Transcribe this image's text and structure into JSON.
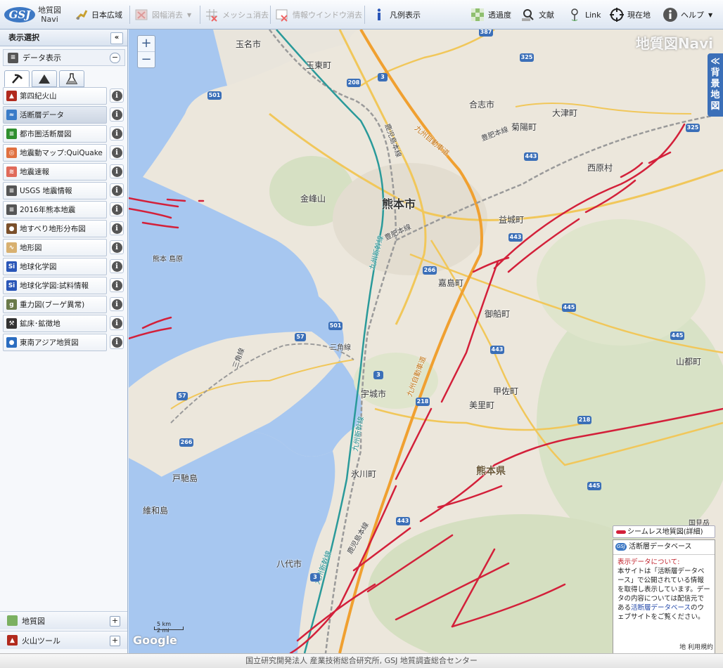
{
  "app": {
    "logo_line1": "地質図",
    "logo_line2": "Navi",
    "logo_badge": "GSJ"
  },
  "toolbar": {
    "japan_wide": "日本広域",
    "clear_legend_img": "図幅消去",
    "clear_mesh": "メッシュ消去",
    "clear_info_window": "情報ウインドウ消去",
    "show_legend": "凡例表示",
    "transparency": "透過度",
    "literature": "文献",
    "link": "Link",
    "current_location": "現在地",
    "help": "ヘルプ"
  },
  "sidebar": {
    "title": "表示選択",
    "data_display": "データ表示",
    "layers": [
      {
        "label": "第四紀火山",
        "color": "#b12a1e",
        "glyph": "▲"
      },
      {
        "label": "活断層データ",
        "color": "#3a7bc8",
        "glyph": "≈"
      },
      {
        "label": "都市圏活断層図",
        "color": "#2f8f2f",
        "glyph": "≡"
      },
      {
        "label": "地震動マップ:QuiQuake",
        "color": "#e07040",
        "glyph": "◎"
      },
      {
        "label": "地震速報",
        "color": "#e06a5a",
        "glyph": "≋"
      },
      {
        "label": "USGS 地震情報",
        "color": "#555555",
        "glyph": "≡"
      },
      {
        "label": "2016年熊本地震",
        "color": "#555555",
        "glyph": "≡"
      },
      {
        "label": "地すべり地形分布図",
        "color": "#7a4f2a",
        "glyph": "●"
      },
      {
        "label": "地形図",
        "color": "#d8b070",
        "glyph": "∿"
      },
      {
        "label": "地球化学図",
        "color": "#2a56b8",
        "glyph": "Si"
      },
      {
        "label": "地球化学図:試料情報",
        "color": "#2a56b8",
        "glyph": "Si"
      },
      {
        "label": "重力図(ブーゲ異常)",
        "color": "#6a7a4a",
        "glyph": "g"
      },
      {
        "label": "鉱床･鉱徴地",
        "color": "#333333",
        "glyph": "⚒"
      },
      {
        "label": "東南アジア地質図",
        "color": "#2a6cc0",
        "glyph": "●"
      }
    ],
    "bottom_groups": [
      {
        "label": "地質図"
      },
      {
        "label": "火山ツール"
      }
    ]
  },
  "map": {
    "watermark": "地質図Navi",
    "bg_tab_chars": [
      "≪",
      "背",
      "景",
      "地",
      "図"
    ],
    "zoom_in": "+",
    "zoom_out": "−",
    "places": {
      "tamana": "玉名市",
      "tamahigashi": "玉東町",
      "koshi": "合志市",
      "ozu": "大津町",
      "kikuyo": "菊陽町",
      "nishihara": "西原村",
      "kinbozan": "金峰山",
      "kumamoto_city": "熊本市",
      "mashiki": "益城町",
      "kumamoto_island": "熊本 島原",
      "kashima": "嘉島町",
      "mifune": "御船町",
      "misato": "美里町",
      "kosa": "甲佐町",
      "uki": "宇城市",
      "yamato": "山都町",
      "kumamoto_pref": "熊本県",
      "hikawa": "氷川町",
      "tochima": "戸馳島",
      "yuwa": "維和島",
      "yatsushiro": "八代市",
      "kokuho": "国見岳"
    },
    "rails": {
      "kagoshima1": "鹿児島本線",
      "kagoshima2": "鹿児島本線",
      "hohi1": "豊肥本線",
      "hohi2": "豊肥本線",
      "misumi": "三角線",
      "misumi2": "三角線",
      "shinkansen1": "九州新幹線",
      "shinkansen2": "九州新幹線",
      "shinkansen3": "九州新幹線",
      "expressway1": "九州自動車道",
      "expressway2": "九州自動車道"
    },
    "routes": {
      "r387": "387",
      "r325a": "325",
      "r325b": "325",
      "r208": "208",
      "r3a": "3",
      "r501a": "501",
      "r443a": "443",
      "r443b": "443",
      "r266a": "266",
      "r443c": "443",
      "r445a": "445",
      "r445b": "445",
      "r501b": "501",
      "r57a": "57",
      "r3b": "3",
      "r218a": "218",
      "r57b": "57",
      "r266b": "266",
      "r218b": "218",
      "r445c": "445",
      "r443d": "443",
      "r3c": "3"
    },
    "scale_text": "5 km\n2 mi",
    "google": "Google",
    "legend_tag": "シームレス地質図(詳細)",
    "terms": "地 利用規約"
  },
  "db_box": {
    "title": "活断層データベース",
    "heading": "表示データについて:",
    "text1": "本サイトは「活断層データベース」で公開されている情報を取得し表示しています。データの内容については配信元である",
    "link": "活断層データベース",
    "text2": "のウェブサイトをご覧ください。"
  },
  "footer": {
    "text": "国立研究開発法人 産業技術総合研究所, GSJ 地質調査総合センター"
  }
}
